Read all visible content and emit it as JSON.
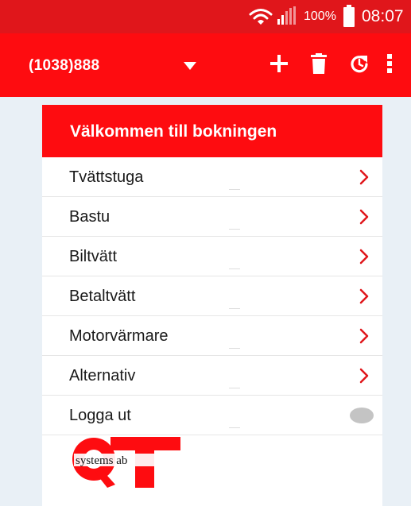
{
  "status_bar": {
    "battery": "100%",
    "time": "08:07"
  },
  "app_bar": {
    "account": "(1038)888",
    "icons": [
      "chevron-down-icon",
      "add-icon",
      "trash-icon",
      "refresh-icon",
      "more-vert-icon"
    ]
  },
  "panel": {
    "title": "Välkommen till bokningen",
    "items": [
      {
        "label": "Tvättstuga"
      },
      {
        "label": "Bastu"
      },
      {
        "label": "Biltvätt"
      },
      {
        "label": "Betaltvätt"
      },
      {
        "label": "Motorvärmare"
      },
      {
        "label": "Alternativ"
      }
    ],
    "logout": {
      "label": "Logga ut"
    },
    "logo": {
      "text": "systems ab"
    }
  },
  "colors": {
    "status_bar": "#e0161b",
    "accent": "#fe0c10",
    "background": "#e9f0f6",
    "chevron": "#e0161b",
    "toggle": "#c4c4c4"
  }
}
